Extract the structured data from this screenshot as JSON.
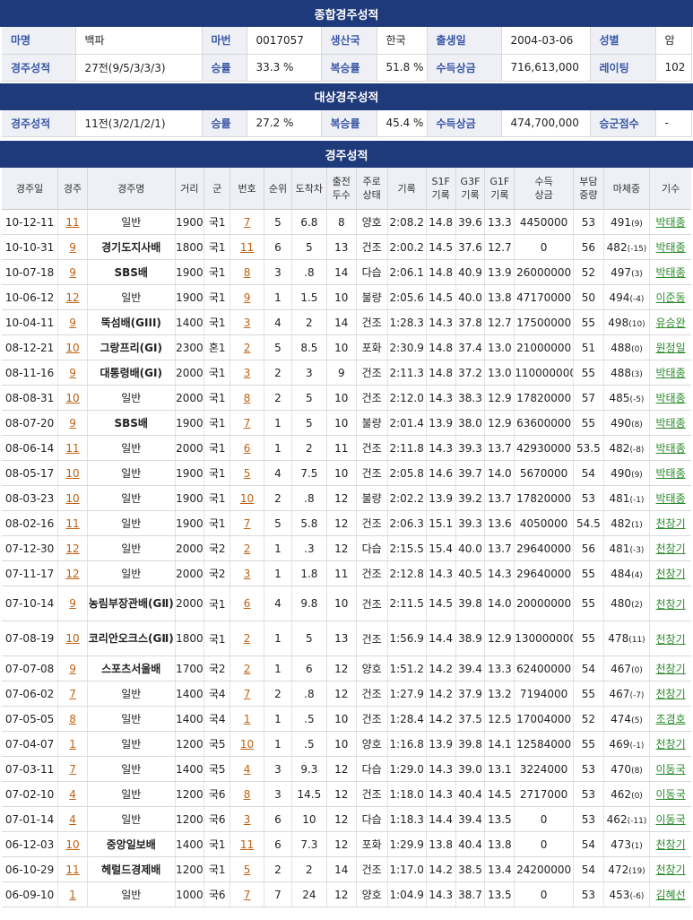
{
  "sections": {
    "overall_title": "종합경주성적",
    "target_title": "대상경주성적",
    "results_title": "경주성적"
  },
  "horse": {
    "name_label": "마명",
    "name": "백파",
    "id_label": "마번",
    "id": "0017057",
    "country_label": "생산국",
    "country": "한국",
    "birth_label": "출생일",
    "birth": "2004-03-06",
    "sex_label": "성별",
    "sex": "암"
  },
  "overall": {
    "record_label": "경주성적",
    "record": "27전(9/5/3/3/3)",
    "win_label": "승률",
    "win": "33.3 %",
    "place_label": "복승률",
    "place": "51.8 %",
    "prize_label": "수득상금",
    "prize": "716,613,000",
    "rating_label": "레이팅",
    "rating": "102"
  },
  "target": {
    "record_label": "경주성적",
    "record": "11전(3/2/1/2/1)",
    "win_label": "승률",
    "win": "27.2 %",
    "place_label": "복승률",
    "place": "45.4 %",
    "prize_label": "수득상금",
    "prize": "474,700,000",
    "points_label": "승군점수",
    "points": "-"
  },
  "results_headers": [
    "경주일",
    "경주",
    "경주명",
    "거리",
    "군",
    "번호",
    "순위",
    "도착차",
    "출전 두수",
    "주로 상태",
    "기록",
    "S1F 기록",
    "G3F 기록",
    "G1F 기록",
    "수득 상금",
    "부담 중량",
    "마체중",
    "기수"
  ],
  "results": [
    {
      "date": "10-12-11",
      "race": "11",
      "name": "일반",
      "dist": "1900",
      "cls": "국1",
      "no": "7",
      "rank": "5",
      "margin": "6.8",
      "runners": "8",
      "track": "양호",
      "time": "2:08.2",
      "s1f": "14.8",
      "g3f": "39.6",
      "g1f": "13.3",
      "prize": "4450000",
      "wt": "53",
      "bw": "491",
      "bwd": "(9)",
      "jockey": "박태종"
    },
    {
      "date": "10-10-31",
      "race": "9",
      "name": "경기도지사배",
      "dist": "1800",
      "cls": "국1",
      "no": "11",
      "rank": "6",
      "margin": "5",
      "runners": "13",
      "track": "건조",
      "time": "2:00.2",
      "s1f": "14.5",
      "g3f": "37.6",
      "g1f": "12.7",
      "prize": "0",
      "wt": "56",
      "bw": "482",
      "bwd": "(-15)",
      "jockey": "박태종"
    },
    {
      "date": "10-07-18",
      "race": "9",
      "name": "SBS배",
      "dist": "1900",
      "cls": "국1",
      "no": "8",
      "rank": "3",
      "margin": ".8",
      "runners": "14",
      "track": "다습",
      "time": "2:06.1",
      "s1f": "14.8",
      "g3f": "40.9",
      "g1f": "13.9",
      "prize": "26000000",
      "wt": "52",
      "bw": "497",
      "bwd": "(3)",
      "jockey": "박태종"
    },
    {
      "date": "10-06-12",
      "race": "12",
      "name": "일반",
      "dist": "1900",
      "cls": "국1",
      "no": "9",
      "rank": "1",
      "margin": "1.5",
      "runners": "10",
      "track": "불량",
      "time": "2:05.6",
      "s1f": "14.5",
      "g3f": "40.0",
      "g1f": "13.8",
      "prize": "47170000",
      "wt": "50",
      "bw": "494",
      "bwd": "(-4)",
      "jockey": "이준동"
    },
    {
      "date": "10-04-11",
      "race": "9",
      "name": "뚝섬배(GIII)",
      "dist": "1400",
      "cls": "국1",
      "no": "3",
      "rank": "4",
      "margin": "2",
      "runners": "14",
      "track": "건조",
      "time": "1:28.3",
      "s1f": "14.3",
      "g3f": "37.8",
      "g1f": "12.7",
      "prize": "17500000",
      "wt": "55",
      "bw": "498",
      "bwd": "(10)",
      "jockey": "유승완"
    },
    {
      "date": "08-12-21",
      "race": "10",
      "name": "그랑프리(GⅠ)",
      "dist": "2300",
      "cls": "혼1",
      "no": "2",
      "rank": "5",
      "margin": "8.5",
      "runners": "10",
      "track": "포화",
      "time": "2:30.9",
      "s1f": "14.8",
      "g3f": "37.4",
      "g1f": "13.0",
      "prize": "21000000",
      "wt": "51",
      "bw": "488",
      "bwd": "(0)",
      "jockey": "원정일"
    },
    {
      "date": "08-11-16",
      "race": "9",
      "name": "대통령배(GⅠ)",
      "dist": "2000",
      "cls": "국1",
      "no": "3",
      "rank": "2",
      "margin": "3",
      "runners": "9",
      "track": "건조",
      "time": "2:11.3",
      "s1f": "14.8",
      "g3f": "37.2",
      "g1f": "13.0",
      "prize": "110000000",
      "wt": "55",
      "bw": "488",
      "bwd": "(3)",
      "jockey": "박태종"
    },
    {
      "date": "08-08-31",
      "race": "10",
      "name": "일반",
      "dist": "2000",
      "cls": "국1",
      "no": "8",
      "rank": "2",
      "margin": "5",
      "runners": "10",
      "track": "건조",
      "time": "2:12.0",
      "s1f": "14.3",
      "g3f": "38.3",
      "g1f": "12.9",
      "prize": "17820000",
      "wt": "57",
      "bw": "485",
      "bwd": "(-5)",
      "jockey": "박태종"
    },
    {
      "date": "08-07-20",
      "race": "9",
      "name": "SBS배",
      "dist": "1900",
      "cls": "국1",
      "no": "7",
      "rank": "1",
      "margin": "5",
      "runners": "10",
      "track": "불량",
      "time": "2:01.4",
      "s1f": "13.9",
      "g3f": "38.0",
      "g1f": "12.9",
      "prize": "63600000",
      "wt": "55",
      "bw": "490",
      "bwd": "(8)",
      "jockey": "박태종"
    },
    {
      "date": "08-06-14",
      "race": "11",
      "name": "일반",
      "dist": "2000",
      "cls": "국1",
      "no": "6",
      "rank": "1",
      "margin": "2",
      "runners": "11",
      "track": "건조",
      "time": "2:11.8",
      "s1f": "14.3",
      "g3f": "39.3",
      "g1f": "13.7",
      "prize": "42930000",
      "wt": "53.5",
      "bw": "482",
      "bwd": "(-8)",
      "jockey": "박태종"
    },
    {
      "date": "08-05-17",
      "race": "10",
      "name": "일반",
      "dist": "1900",
      "cls": "국1",
      "no": "5",
      "rank": "4",
      "margin": "7.5",
      "runners": "10",
      "track": "건조",
      "time": "2:05.8",
      "s1f": "14.6",
      "g3f": "39.7",
      "g1f": "14.0",
      "prize": "5670000",
      "wt": "54",
      "bw": "490",
      "bwd": "(9)",
      "jockey": "박태종"
    },
    {
      "date": "08-03-23",
      "race": "10",
      "name": "일반",
      "dist": "1900",
      "cls": "국1",
      "no": "10",
      "rank": "2",
      "margin": ".8",
      "runners": "12",
      "track": "불량",
      "time": "2:02.2",
      "s1f": "13.9",
      "g3f": "39.2",
      "g1f": "13.7",
      "prize": "17820000",
      "wt": "53",
      "bw": "481",
      "bwd": "(-1)",
      "jockey": "박태종"
    },
    {
      "date": "08-02-16",
      "race": "11",
      "name": "일반",
      "dist": "1900",
      "cls": "국1",
      "no": "7",
      "rank": "5",
      "margin": "5.8",
      "runners": "12",
      "track": "건조",
      "time": "2:06.3",
      "s1f": "15.1",
      "g3f": "39.3",
      "g1f": "13.6",
      "prize": "4050000",
      "wt": "54.5",
      "bw": "482",
      "bwd": "(1)",
      "jockey": "천창기"
    },
    {
      "date": "07-12-30",
      "race": "12",
      "name": "일반",
      "dist": "2000",
      "cls": "국2",
      "no": "2",
      "rank": "1",
      "margin": ".3",
      "runners": "12",
      "track": "다습",
      "time": "2:15.5",
      "s1f": "15.4",
      "g3f": "40.0",
      "g1f": "13.7",
      "prize": "29640000",
      "wt": "56",
      "bw": "481",
      "bwd": "(-3)",
      "jockey": "천창기"
    },
    {
      "date": "07-11-17",
      "race": "12",
      "name": "일반",
      "dist": "2000",
      "cls": "국2",
      "no": "3",
      "rank": "1",
      "margin": "1.8",
      "runners": "11",
      "track": "건조",
      "time": "2:12.8",
      "s1f": "14.3",
      "g3f": "40.5",
      "g1f": "14.3",
      "prize": "29640000",
      "wt": "55",
      "bw": "484",
      "bwd": "(4)",
      "jockey": "천창기"
    },
    {
      "date": "07-10-14",
      "race": "9",
      "name": "농림부장관배(GⅡ)",
      "dist": "2000",
      "cls": "국1",
      "no": "6",
      "rank": "4",
      "margin": "9.8",
      "runners": "10",
      "track": "건조",
      "time": "2:11.5",
      "s1f": "14.5",
      "g3f": "39.8",
      "g1f": "14.0",
      "prize": "20000000",
      "wt": "55",
      "bw": "480",
      "bwd": "(2)",
      "jockey": "천창기",
      "tall": true
    },
    {
      "date": "07-08-19",
      "race": "10",
      "name": "코리안오크스(GⅡ)",
      "dist": "1800",
      "cls": "국1",
      "no": "2",
      "rank": "1",
      "margin": "5",
      "runners": "13",
      "track": "건조",
      "time": "1:56.9",
      "s1f": "14.4",
      "g3f": "38.9",
      "g1f": "12.9",
      "prize": "130000000",
      "wt": "55",
      "bw": "478",
      "bwd": "(11)",
      "jockey": "천창기",
      "tall": true
    },
    {
      "date": "07-07-08",
      "race": "9",
      "name": "스포츠서울배",
      "dist": "1700",
      "cls": "국2",
      "no": "2",
      "rank": "1",
      "margin": "6",
      "runners": "12",
      "track": "양호",
      "time": "1:51.2",
      "s1f": "14.2",
      "g3f": "39.4",
      "g1f": "13.3",
      "prize": "62400000",
      "wt": "54",
      "bw": "467",
      "bwd": "(0)",
      "jockey": "천창기"
    },
    {
      "date": "07-06-02",
      "race": "7",
      "name": "일반",
      "dist": "1400",
      "cls": "국4",
      "no": "7",
      "rank": "2",
      "margin": ".8",
      "runners": "12",
      "track": "건조",
      "time": "1:27.9",
      "s1f": "14.2",
      "g3f": "37.9",
      "g1f": "13.2",
      "prize": "7194000",
      "wt": "55",
      "bw": "467",
      "bwd": "(-7)",
      "jockey": "천창기"
    },
    {
      "date": "07-05-05",
      "race": "8",
      "name": "일반",
      "dist": "1400",
      "cls": "국4",
      "no": "1",
      "rank": "1",
      "margin": ".5",
      "runners": "10",
      "track": "건조",
      "time": "1:28.4",
      "s1f": "14.2",
      "g3f": "37.5",
      "g1f": "12.5",
      "prize": "17004000",
      "wt": "52",
      "bw": "474",
      "bwd": "(5)",
      "jockey": "조경호"
    },
    {
      "date": "07-04-07",
      "race": "1",
      "name": "일반",
      "dist": "1200",
      "cls": "국5",
      "no": "10",
      "rank": "1",
      "margin": ".5",
      "runners": "10",
      "track": "양호",
      "time": "1:16.8",
      "s1f": "13.9",
      "g3f": "39.8",
      "g1f": "14.1",
      "prize": "12584000",
      "wt": "55",
      "bw": "469",
      "bwd": "(-1)",
      "jockey": "천창기"
    },
    {
      "date": "07-03-11",
      "race": "7",
      "name": "일반",
      "dist": "1400",
      "cls": "국5",
      "no": "4",
      "rank": "3",
      "margin": "9.3",
      "runners": "12",
      "track": "다습",
      "time": "1:29.0",
      "s1f": "14.3",
      "g3f": "39.0",
      "g1f": "13.1",
      "prize": "3224000",
      "wt": "53",
      "bw": "470",
      "bwd": "(8)",
      "jockey": "이동국"
    },
    {
      "date": "07-02-10",
      "race": "4",
      "name": "일반",
      "dist": "1200",
      "cls": "국6",
      "no": "8",
      "rank": "3",
      "margin": "14.5",
      "runners": "12",
      "track": "건조",
      "time": "1:18.0",
      "s1f": "14.3",
      "g3f": "40.4",
      "g1f": "14.5",
      "prize": "2717000",
      "wt": "53",
      "bw": "462",
      "bwd": "(0)",
      "jockey": "이동국"
    },
    {
      "date": "07-01-14",
      "race": "4",
      "name": "일반",
      "dist": "1200",
      "cls": "국6",
      "no": "3",
      "rank": "6",
      "margin": "10",
      "runners": "12",
      "track": "다습",
      "time": "1:18.3",
      "s1f": "14.4",
      "g3f": "39.4",
      "g1f": "13.5",
      "prize": "0",
      "wt": "53",
      "bw": "462",
      "bwd": "(-11)",
      "jockey": "이동국"
    },
    {
      "date": "06-12-03",
      "race": "10",
      "name": "중앙일보배",
      "dist": "1400",
      "cls": "국1",
      "no": "11",
      "rank": "6",
      "margin": "7.3",
      "runners": "12",
      "track": "포화",
      "time": "1:29.9",
      "s1f": "13.8",
      "g3f": "40.4",
      "g1f": "13.8",
      "prize": "0",
      "wt": "54",
      "bw": "473",
      "bwd": "(1)",
      "jockey": "천창기"
    },
    {
      "date": "06-10-29",
      "race": "11",
      "name": "헤럴드경제배",
      "dist": "1200",
      "cls": "국1",
      "no": "5",
      "rank": "2",
      "margin": "2",
      "runners": "14",
      "track": "건조",
      "time": "1:17.0",
      "s1f": "14.2",
      "g3f": "38.5",
      "g1f": "13.4",
      "prize": "24200000",
      "wt": "54",
      "bw": "472",
      "bwd": "(19)",
      "jockey": "천창기"
    },
    {
      "date": "06-09-10",
      "race": "1",
      "name": "일반",
      "dist": "1000",
      "cls": "국6",
      "no": "7",
      "rank": "7",
      "margin": "24",
      "runners": "12",
      "track": "양호",
      "time": "1:04.9",
      "s1f": "14.3",
      "g3f": "38.7",
      "g1f": "13.5",
      "prize": "0",
      "wt": "53",
      "bw": "453",
      "bwd": "(-6)",
      "jockey": "김혜선"
    }
  ]
}
